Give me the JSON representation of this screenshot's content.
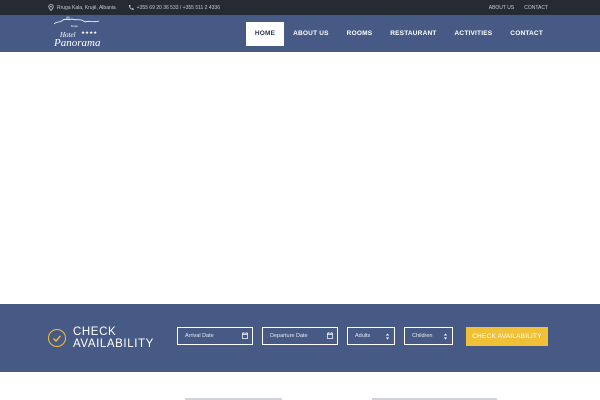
{
  "topbar": {
    "address": "Rruga Kala, Krujë, Albania",
    "phone": "+355 69 20 36 533 / +355 511 2 4336",
    "links": [
      "ABOUT US",
      "CONTACT"
    ]
  },
  "header": {
    "logo_top": "Hotel",
    "logo_stars": "★★★★",
    "logo_main": "Panorama",
    "logo_small": "Kruje",
    "nav": [
      "HOME",
      "ABOUT US",
      "ROOMS",
      "RESTAURANT",
      "ACTIVITIES",
      "CONTACT"
    ],
    "active": "HOME"
  },
  "booking": {
    "title_line1": "CHECK",
    "title_line2": "AVAILABILITY",
    "arrival_placeholder": "Arrival Date",
    "departure_placeholder": "Departure Date",
    "adults_label": "Adults",
    "children_label": "Children",
    "button_label": "CHECK AVAILABILITY"
  },
  "colors": {
    "topbar_bg": "#262a33",
    "header_bg": "#465a85",
    "accent": "#f0c036",
    "nav_active_bg": "#ffffff"
  },
  "icons": [
    "map-pin-icon",
    "phone-icon",
    "check-circle-icon",
    "calendar-icon",
    "select-arrows-icon"
  ]
}
